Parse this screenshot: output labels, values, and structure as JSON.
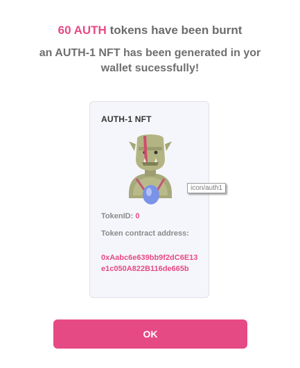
{
  "headline": {
    "amount": "60 AUTH",
    "rest": "tokens have been burnt"
  },
  "subline": "an AUTH-1 NFT has been generated in yor wallet sucessfully!",
  "card": {
    "title": "AUTH-1 NFT",
    "image_tooltip": "icon/auth1",
    "token_id_label": "TokenID:",
    "token_id_value": "0",
    "contract_label": "Token contract address:",
    "contract_address": "0xAabc6e639bb9f2dC6E13e1c050A822B116de665b"
  },
  "button": {
    "ok_label": "OK"
  },
  "colors": {
    "accent": "#e64a85",
    "text_gray": "#6b6b6b",
    "card_bg": "#f5f6fb"
  }
}
